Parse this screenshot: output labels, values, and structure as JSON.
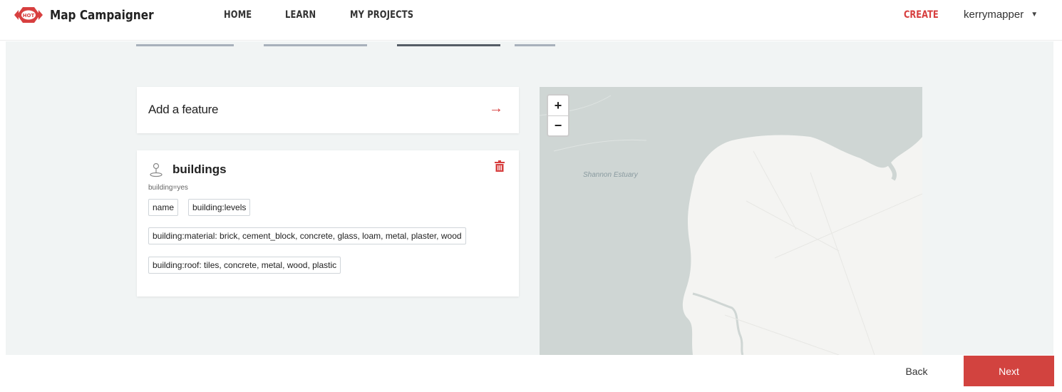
{
  "header": {
    "app_title": "Map Campaigner",
    "nav": [
      "HOME",
      "LEARN",
      "MY PROJECTS"
    ],
    "create_label": "CREATE",
    "username": "kerrymapper",
    "logo_icon": "hot-logo",
    "brand_color": "#d73f3f"
  },
  "steps": {
    "count": 4,
    "active_index": 2
  },
  "add_feature": {
    "title": "Add a feature",
    "arrow": "→"
  },
  "feature": {
    "name": "buildings",
    "osm_tag": "building=yes",
    "attributes": [
      "name",
      "building:levels",
      "building:material: brick, cement_block, concrete, glass, loam, metal, plaster, wood",
      "building:roof: tiles, concrete, metal, wood, plastic"
    ]
  },
  "map": {
    "label": "Shannon Estuary",
    "zoom_in": "+",
    "zoom_out": "−",
    "water_color": "#cfd6d4",
    "land_color": "#f4f4f2"
  },
  "footer": {
    "back_label": "Back",
    "next_label": "Next",
    "next_color": "#d2433f"
  }
}
